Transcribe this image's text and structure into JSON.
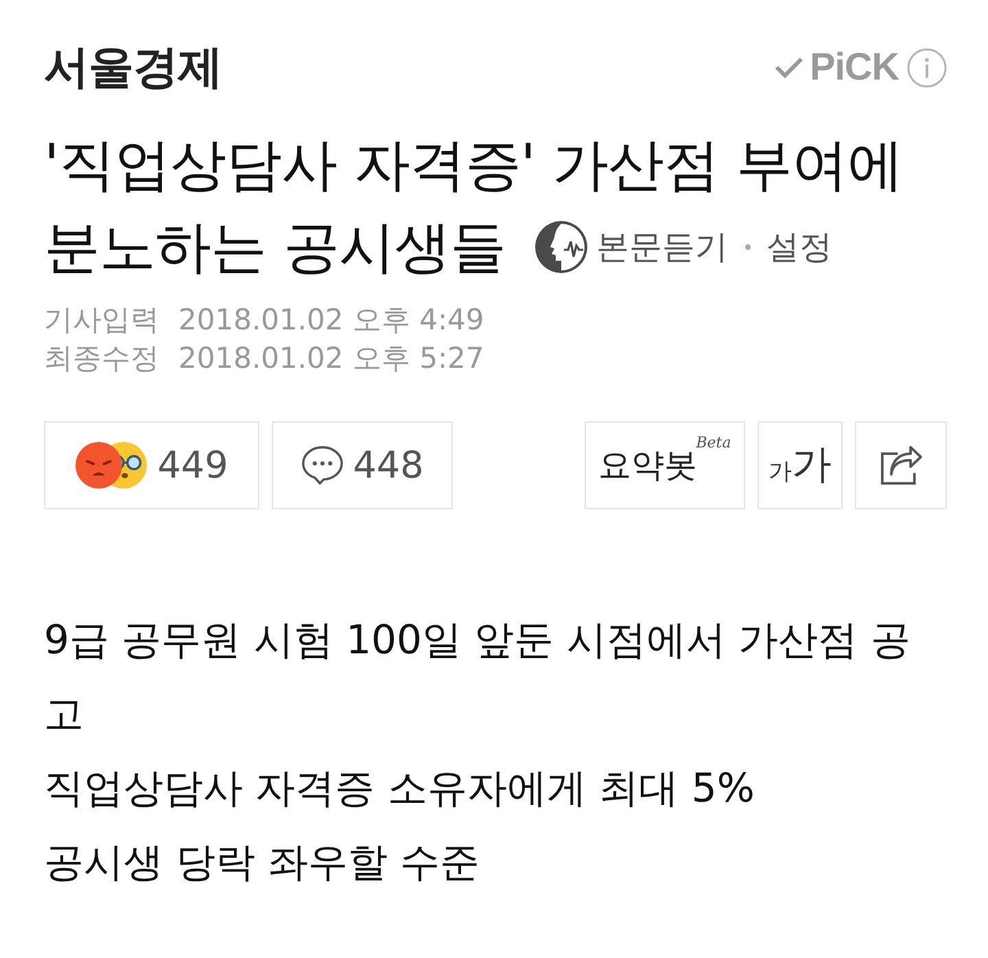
{
  "header": {
    "publisher": "서울경제",
    "pick_label": "PiCK"
  },
  "headline": {
    "title_lines": [
      "'직업상담사 자격증' 가산점 부여에",
      "분노하는 공시생들"
    ],
    "listen": {
      "label": "본문듣기",
      "settings": "설정"
    }
  },
  "dates": [
    {
      "label": "기사입력",
      "value": "2018.01.02 오후 4:49"
    },
    {
      "label": "최종수정",
      "value": "2018.01.02 오후 5:27"
    }
  ],
  "actions": {
    "reactions": {
      "count": "449"
    },
    "comments": {
      "count": "448"
    },
    "summary": {
      "label": "요약봇",
      "badge": "Beta"
    },
    "font_size": {
      "small": "가",
      "large": "가"
    }
  },
  "body": {
    "lines": [
      "9급 공무원 시험 100일 앞둔 시점에서 가산점 공고",
      "직업상담사 자격증 소유자에게 최대 5%",
      "공시생 당락 좌우할 수준"
    ]
  }
}
